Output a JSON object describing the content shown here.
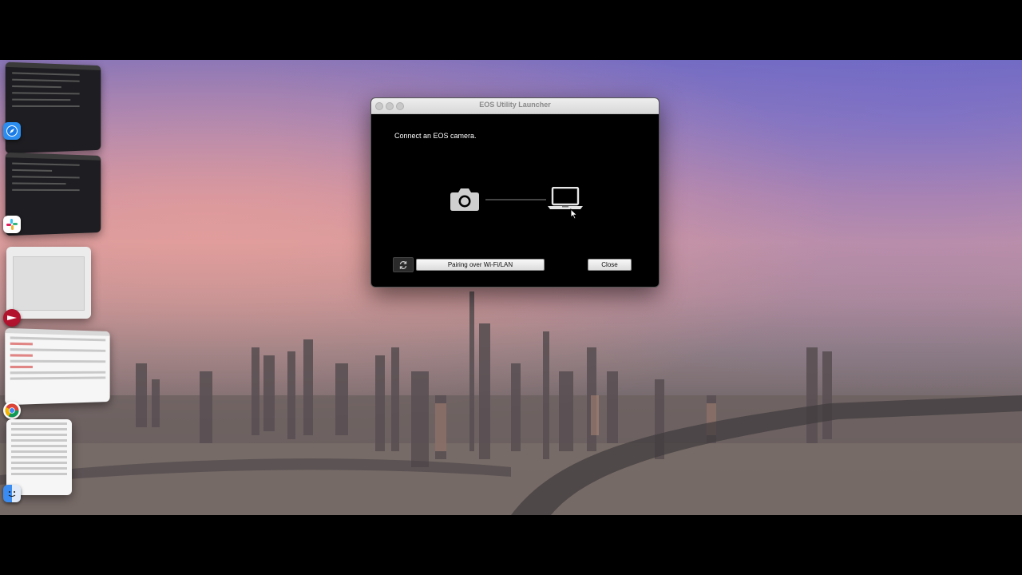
{
  "window": {
    "title": "EOS Utility Launcher",
    "prompt": "Connect an EOS camera.",
    "buttons": {
      "pair_label": "Pairing over Wi-Fi/LAN",
      "close_label": "Close"
    }
  },
  "icons": {
    "refresh": "refresh-icon",
    "camera": "camera-icon",
    "laptop": "laptop-icon",
    "cursor": "cursor-icon"
  },
  "stage_apps": [
    {
      "name": "Safari",
      "icon": "safari-icon"
    },
    {
      "name": "Slack",
      "icon": "slack-icon"
    },
    {
      "name": "App",
      "icon": "red-app-icon"
    },
    {
      "name": "Chrome",
      "icon": "chrome-icon"
    },
    {
      "name": "Finder",
      "icon": "finder-icon"
    }
  ],
  "colors": {
    "dialog_bg": "#000000",
    "titlebar": "#e3e3e3",
    "text": "#ffffff"
  }
}
